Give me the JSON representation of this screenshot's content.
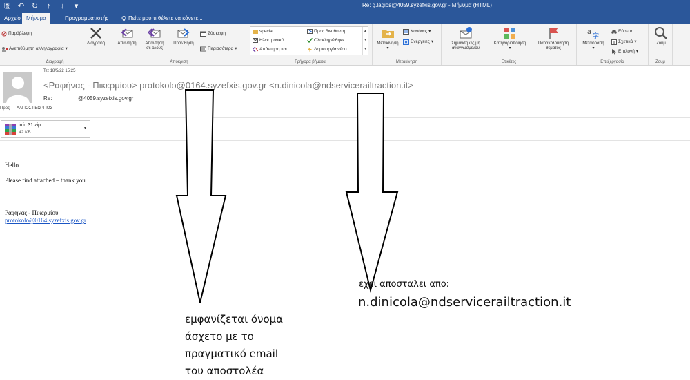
{
  "titlebar": {
    "window_title": "Re: g.lagios@4059.syzefxis.gov.gr - Μήνυμα (HTML)"
  },
  "tabs": [
    {
      "label": "Αρχείο"
    },
    {
      "label": "Μήνυμα"
    },
    {
      "label": "Προγραμματιστής"
    }
  ],
  "tellme": {
    "text": "Πείτε μου τι θέλετε να κάνετε..."
  },
  "ribbon": {
    "delete": {
      "ignore": "Παράβλεψη",
      "junk": "Ανεπιθύμητη αλληλογραφία",
      "delete": "Διαγραφή",
      "group": "Διαγραφή"
    },
    "respond": {
      "reply": "Απάντηση",
      "reply_all_1": "Απάντηση",
      "reply_all_2": "σε όλους",
      "forward": "Προώθηση",
      "meeting": "Σύσκεψη",
      "more": "Περισσότερα",
      "group": "Απόκριση"
    },
    "quicksteps": {
      "items": [
        "special",
        "Ηλεκτρονικό τ...",
        "Απάντηση και...",
        "Προς διευθυντή",
        "Ολοκληρώθηκε",
        "Δημιουργία νέου"
      ],
      "group": "Γρήγορα βήματα"
    },
    "move": {
      "move": "Μετακίνηση",
      "rules": "Κανόνες",
      "actions": "Ενέργειες",
      "group": "Μετακίνηση"
    },
    "tags": {
      "unread_1": "Σήμανση ως μη",
      "unread_2": "αναγνωσμένου",
      "categorize": "Κατηγοριοποίηση",
      "followup_1": "Παρακολούθηση",
      "followup_2": "θέματος",
      "group": "Ετικέτες"
    },
    "editing": {
      "translate": "Μετάφραση",
      "find": "Εύρεση",
      "related": "Σχετικά",
      "select": "Επιλογή",
      "group": "Επεξεργασία"
    },
    "zoom": {
      "zoom": "Ζουμ",
      "group": "Ζουμ"
    }
  },
  "message": {
    "date": "Τετ 18/5/22 15:25",
    "from": "<Ραφήνας - Πικερμίου> protokolo@0164.syzefxis.gov.gr <n.dinicola@ndservicerailtraction.it>",
    "re_label": "Re:",
    "subject": "@4059.syzefxis.gov.gr",
    "to_label": "Προς",
    "to_name": "ΛΑΓΙΟΣ ΓΕΩΡΓΙΟΣ",
    "attachment": {
      "name": "info 31.zip",
      "size": "42 KB"
    },
    "body": {
      "greeting": "Hello",
      "line": "Please find attached – thank you",
      "sig_name": "Ραφήνας - Πικερμίου",
      "sig_email": "protokolo@0164.syzefxis.gov.gr"
    }
  },
  "annotations": {
    "left": [
      "εμφανίζεται όνομα",
      "άσχετο με το",
      "πραγματικό email",
      "του αποστολέα"
    ],
    "right_1": "εχει αποσταλει απο:",
    "right_2": "n.dinicola@ndservicerailtraction.it"
  }
}
